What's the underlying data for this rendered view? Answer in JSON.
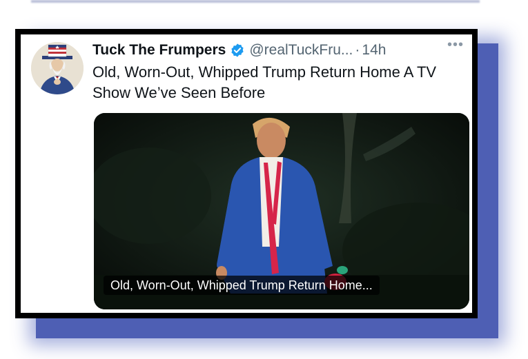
{
  "tweet": {
    "display_name": "Tuck The Frumpers",
    "handle": "@realTuckFru...",
    "separator": "·",
    "time": "14h",
    "more": "•••",
    "text": "Old, Worn-Out, Whipped Trump Return Home A TV Show We’ve Seen Before",
    "verified_color": "#1d9bf0"
  },
  "media": {
    "caption": "Old, Worn-Out, Whipped Trump Return Home..."
  },
  "icons": {
    "avatar": "uncle-sam-avatar",
    "verified": "verified-badge-icon",
    "more": "more-options-icon"
  }
}
